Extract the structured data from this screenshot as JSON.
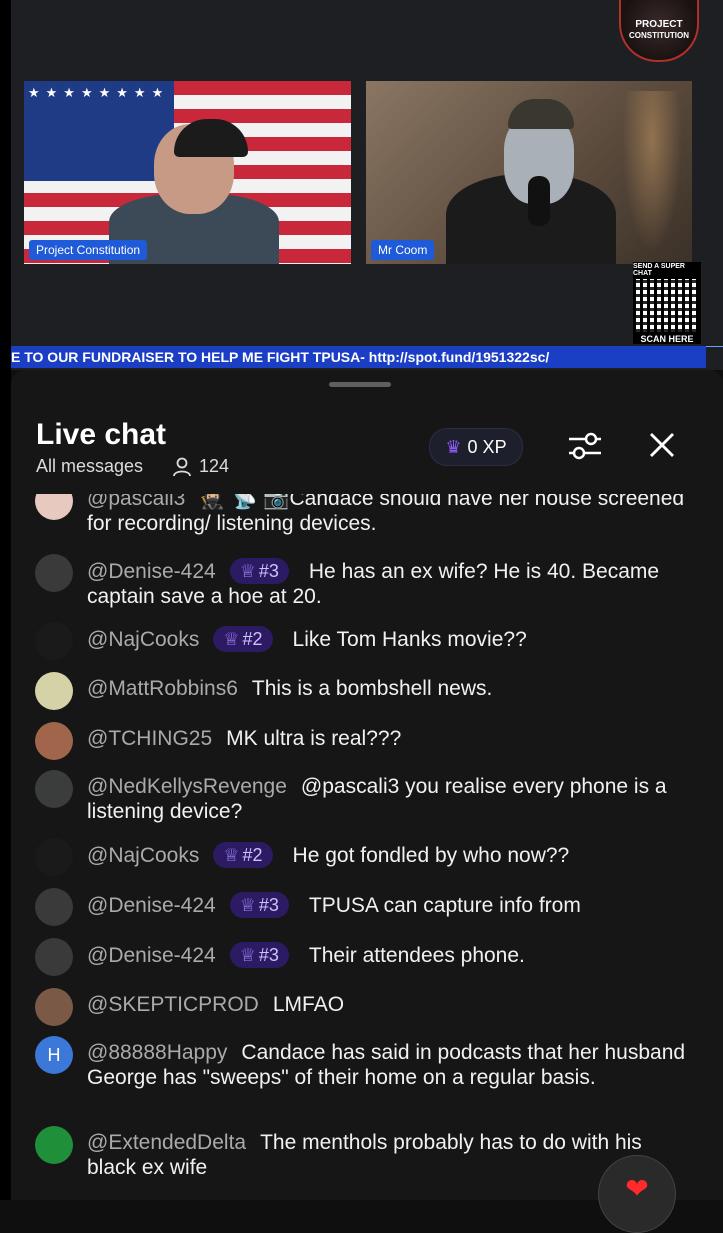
{
  "stream": {
    "logo_line1": "PROJECT",
    "logo_line2": "CONSTITUTION",
    "cam1_name": "Project Constitution",
    "cam2_name": "Mr Coom",
    "qr_top": "SEND A SUPER CHAT",
    "qr_bottom": "SCAN HERE",
    "ticker": "E TO OUR FUNDRAISER TO HELP ME FIGHT TPUSA- http://spot.fund/1951322sc/"
  },
  "chat": {
    "title": "Live chat",
    "filter": "All messages",
    "viewer_count": "124",
    "xp": "0 XP",
    "messages": [
      {
        "author": "@pascali3",
        "badge": "",
        "text": "🥷🏼 📡 📷Candace should have her house screened for recording/ listening devices.",
        "avatar_color": "#e7c9c0",
        "avatar_letter": ""
      },
      {
        "author": "@Denise-424",
        "badge": "#3",
        "text": "He has an ex wife? He is 40. Became captain save a hoe at 20.",
        "avatar_color": "#3a3a3a",
        "avatar_letter": ""
      },
      {
        "author": "@NajCooks",
        "badge": "#2",
        "text": "Like Tom Hanks movie??",
        "avatar_color": "#1a1a1a",
        "avatar_letter": ""
      },
      {
        "author": "@MattRobbins6",
        "badge": "",
        "text": "This is a bombshell news.",
        "avatar_color": "#d6d2a8",
        "avatar_letter": ""
      },
      {
        "author": "@TCHING25",
        "badge": "",
        "text": "MK ultra is real???",
        "avatar_color": "#a0654a",
        "avatar_letter": ""
      },
      {
        "author": "@NedKellysRevenge",
        "badge": "",
        "text": "@pascali3 you realise every phone is a listening device?",
        "avatar_color": "#3b3d3c",
        "avatar_letter": ""
      },
      {
        "author": "@NajCooks",
        "badge": "#2",
        "text": "He got fondled by who now??",
        "avatar_color": "#1a1a1a",
        "avatar_letter": ""
      },
      {
        "author": "@Denise-424",
        "badge": "#3",
        "text": "TPUSA can capture info from",
        "avatar_color": "#3a3a3a",
        "avatar_letter": ""
      },
      {
        "author": "@Denise-424",
        "badge": "#3",
        "text": "Their attendees phone.",
        "avatar_color": "#3a3a3a",
        "avatar_letter": ""
      },
      {
        "author": "@SKEPTICPROD",
        "badge": "",
        "text": "LMFAO",
        "avatar_color": "#7a5a46",
        "avatar_letter": ""
      },
      {
        "author": "@88888Happy",
        "badge": "",
        "text": "Candace has said in podcasts that her husband George has \"sweeps\" of their home on a regular basis.",
        "avatar_color": "#3b78d8",
        "avatar_letter": "H"
      },
      {
        "author": "@ExtendedDelta",
        "badge": "",
        "text": "The menthols probably has to do with his black ex wife",
        "avatar_color": "#1f8f3a",
        "avatar_letter": ""
      }
    ]
  },
  "colors": {
    "accent_purple": "#8b5cf6",
    "ticker_blue": "#1b3fc4",
    "heart": "#ff2a2a"
  },
  "icons": [
    "crown-icon",
    "person-icon",
    "tune-icon",
    "close-icon",
    "heart-icon"
  ]
}
